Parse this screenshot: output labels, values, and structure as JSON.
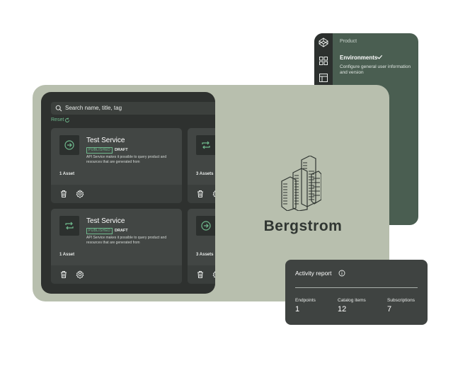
{
  "side_panel": {
    "section_label": "Product",
    "active_item": "Environments",
    "active_item_desc": "Configure general user information and version",
    "rail_icons": [
      "codepen-icon",
      "grid-icon",
      "layout-icon"
    ]
  },
  "brand": {
    "name": "Bergstrom"
  },
  "search": {
    "placeholder": "Search name, title, tag",
    "reset_label": "Reset"
  },
  "cards": [
    {
      "title": "Test Service",
      "status_published": "PUBLISHED",
      "status_draft": "DRAFT",
      "description": "API Service makes it possible to query product and resources that are generated from",
      "assets": "1 Asset",
      "icon": "arrow-circle-right-icon"
    },
    {
      "title": "",
      "assets": "3 Assets",
      "icon": "repeat-icon"
    },
    {
      "title": "Test Service",
      "status_published": "PUBLISHED",
      "status_draft": "DRAFT",
      "description": "API Service makes it possible to query product and resources that are generated from",
      "assets": "1 Asset",
      "icon": "repeat-icon"
    },
    {
      "title": "",
      "assets": "3 Assets",
      "icon": "arrow-circle-right-icon"
    }
  ],
  "activity": {
    "title": "Activity report",
    "stats": [
      {
        "label": "Endpoints",
        "value": "1"
      },
      {
        "label": "Catalog items",
        "value": "12"
      },
      {
        "label": "Subscriptions",
        "value": "7"
      }
    ]
  },
  "colors": {
    "accent": "#6fb98d",
    "panel_green": "#4a5e51",
    "sage": "#b8bfae",
    "screen": "#2e312f"
  }
}
